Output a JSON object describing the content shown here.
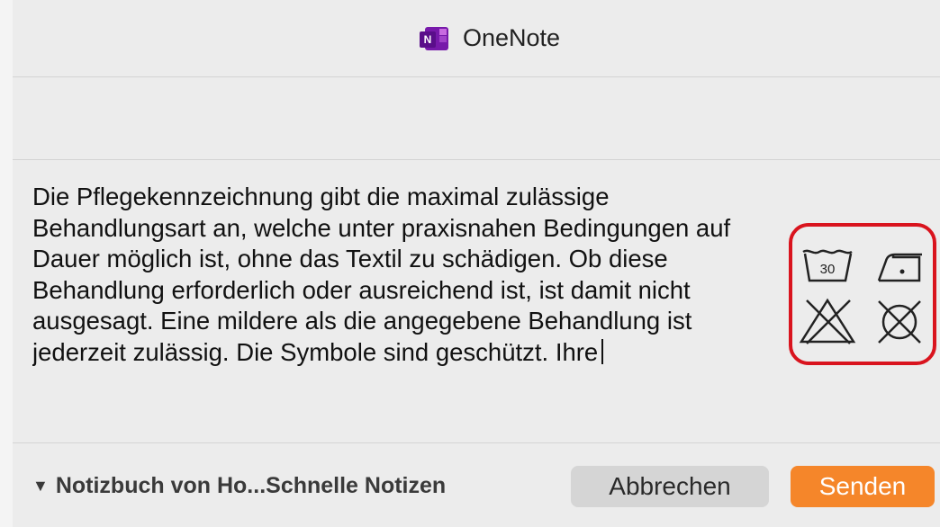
{
  "window": {
    "title": "OneNote",
    "app_icon_letter": "N"
  },
  "note": {
    "text": "Die Pflegekennzeichnung gibt die maximal zulässige Behandlungsart an, welche unter praxisnahen Bedingungen auf Dauer möglich ist, ohne das Textil zu schädigen. Ob diese Behandlung erforderlich oder ausreichend ist, ist damit nicht ausgesagt. Eine mildere als die angegebene Behandlung ist jederzeit zulässig. Die Symbole sind geschützt. Ihre",
    "care_symbols": [
      {
        "name": "wash-30-icon",
        "label": "30"
      },
      {
        "name": "iron-low-icon"
      },
      {
        "name": "no-bleach-icon"
      },
      {
        "name": "no-tumble-dry-icon"
      }
    ]
  },
  "footer": {
    "notebook_location": "Notizbuch von Ho...Schnelle Notizen",
    "cancel_label": "Abbrechen",
    "send_label": "Senden"
  },
  "colors": {
    "accent": "#f5862a",
    "highlight_border": "#d9141e",
    "onenote_purple": "#7719aa"
  }
}
